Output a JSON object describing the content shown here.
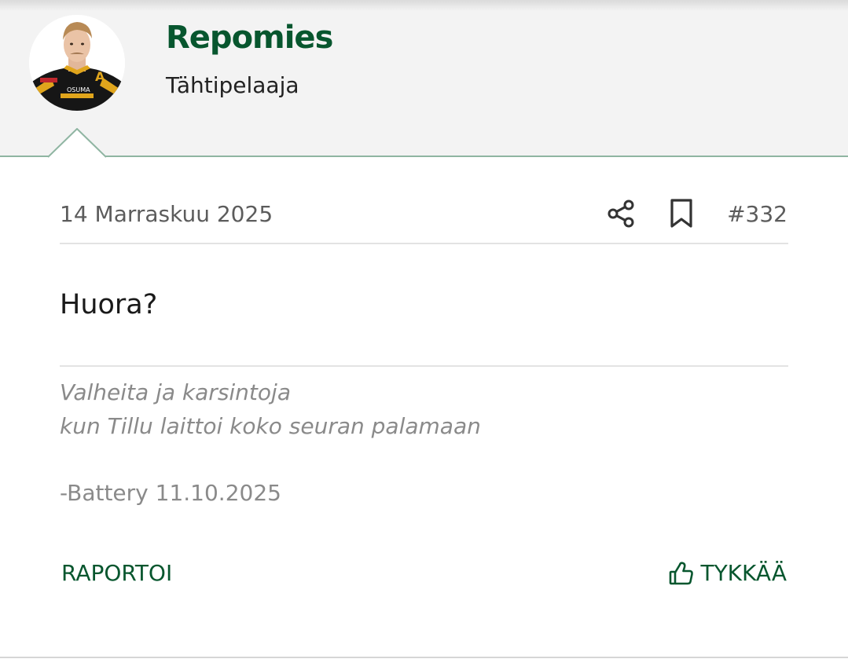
{
  "author": {
    "name": "Repomies",
    "rank": "Tähtipelaaja",
    "avatar_icon": "player-avatar"
  },
  "post": {
    "date": "14 Marraskuu 2025",
    "number": "#332",
    "body": "Huora?",
    "share_icon": "share-icon",
    "bookmark_icon": "bookmark-icon"
  },
  "signature": {
    "lines": [
      "Valheita ja karsintoja",
      "kun Tillu laittoi koko seuran palamaan"
    ],
    "credit": "-Battery 11.10.2025"
  },
  "actions": {
    "report_label": "RAPORTOI",
    "like_label": "TYKKÄÄ",
    "like_icon": "thumbs-up-icon"
  },
  "colors": {
    "brand_green": "#07562e",
    "header_bg": "#f3f3f3",
    "accent_border": "#8fb5a2",
    "meta_text": "#5c5c5c",
    "signature_text": "#8a8a8a"
  }
}
